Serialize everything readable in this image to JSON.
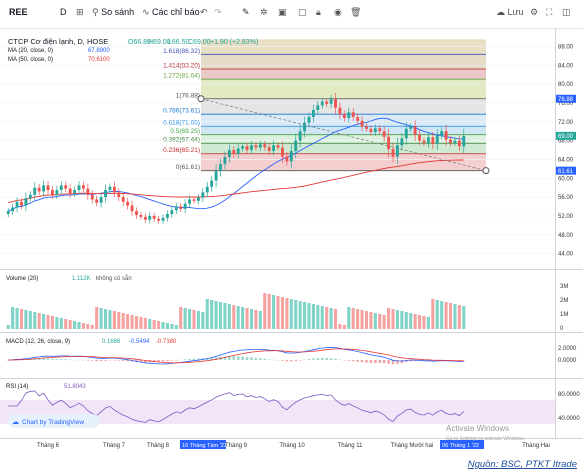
{
  "toolbar": {
    "symbol": "REE",
    "interval": "D",
    "compare_label": "So sánh",
    "indicators_label": "Các chỉ báo",
    "save_label": "Lưu"
  },
  "chart_data": [
    {
      "type": "candlestick",
      "title": "CTCP Cơ điện lạnh, D, HOSE",
      "ohlc_header": {
        "o": "O66.80",
        "h": "H69.00",
        "l": "L66.50",
        "c": "C69.00",
        "change": "+1.90 (+2.83%)"
      },
      "indicators": [
        {
          "name": "MA (20, close, 0)",
          "value": "67.8900",
          "color": "#2962ff"
        },
        {
          "name": "MA (50, close, 0)",
          "value": "70.6100",
          "color": "#e53935"
        }
      ],
      "price_axis_ticks": [
        "88.00",
        "84.00",
        "80.00",
        "76.00",
        "72.00",
        "68.00",
        "64.00",
        "60.00",
        "56.00",
        "52.00",
        "48.00",
        "44.00"
      ],
      "price_badges": [
        {
          "text": "76.88",
          "color": "#2962ff"
        },
        {
          "text": "69.00",
          "color": "#26a69a"
        },
        {
          "text": "61.61",
          "color": "#2962ff"
        }
      ],
      "fibonacci_levels": [
        {
          "label": "1.618(86.32)",
          "value": 86.32,
          "color": "#3f51b5"
        },
        {
          "label": "1.414(83.20)",
          "value": 83.2,
          "color": "#b71c1c"
        },
        {
          "label": "1.272(81.04)",
          "value": 81.04,
          "color": "#689f38"
        },
        {
          "label": "1(76.88)",
          "value": 76.88,
          "color": "#555555"
        },
        {
          "label": "0.786(73.61)",
          "value": 73.61,
          "color": "#1976d2"
        },
        {
          "label": "0.618(71.05)",
          "value": 71.05,
          "color": "#1e88e5"
        },
        {
          "label": "0.5(69.25)",
          "value": 69.25,
          "color": "#43a047"
        },
        {
          "label": "0.382(67.44)",
          "value": 67.44,
          "color": "#2e7d32"
        },
        {
          "label": "0.236(65.21)",
          "value": 65.21,
          "color": "#c62828"
        },
        {
          "label": "0(61.61)",
          "value": 61.61,
          "color": "#555555"
        }
      ],
      "close_series": [
        53.0,
        53.8,
        55.0,
        54.2,
        55.8,
        56.5,
        58.0,
        57.2,
        58.5,
        57.5,
        56.5,
        57.5,
        58.5,
        57.8,
        56.8,
        57.5,
        58.5,
        57.8,
        56.5,
        55.5,
        54.8,
        56.0,
        57.5,
        58.2,
        57.0,
        56.0,
        55.0,
        54.2,
        53.0,
        52.2,
        51.8,
        51.2,
        52.0,
        51.4,
        51.0,
        51.6,
        52.4,
        53.2,
        54.0,
        53.5,
        54.6,
        55.5,
        55.2,
        55.9,
        57.0,
        58.2,
        59.5,
        61.5,
        63.0,
        64.5,
        66.0,
        65.2,
        66.3,
        66.8,
        66.0,
        67.0,
        66.5,
        67.2,
        66.6,
        65.8,
        67.0,
        66.5,
        64.6,
        63.6,
        65.8,
        68.0,
        70.0,
        71.8,
        73.0,
        74.5,
        75.5,
        76.3,
        75.8,
        76.8,
        75.0,
        73.6,
        72.8,
        74.0,
        73.0,
        72.2,
        71.0,
        70.5,
        69.8,
        70.6,
        70.0,
        68.8,
        66.2,
        64.6,
        67.0,
        68.5,
        70.5,
        71.0,
        69.2,
        68.0,
        67.5,
        68.7,
        67.3,
        69.1,
        70.0,
        68.2,
        67.5,
        68.0,
        66.8,
        69.0
      ],
      "volume_axis_ticks": [
        "3M",
        "2M",
        "1M",
        "0"
      ],
      "macd_axis_ticks": [
        "2.0000",
        "0.0000"
      ],
      "rsi_axis_ticks": [
        "80.0000",
        "40.0000"
      ],
      "time_ticks": [
        "Tháng 6",
        "Tháng 7",
        "Tháng 8",
        "Tháng 9",
        "Tháng 10",
        "Tháng 11",
        "Tháng Mười hai",
        "Tháng Hai"
      ],
      "highlight_dates": [
        "16 Tháng Tám '21",
        "06 Tháng 1 '22"
      ]
    },
    {
      "type": "bar",
      "title": "Volume (20)",
      "values_label": "1.112K",
      "note": "không có sẵn"
    },
    {
      "type": "line",
      "title": "MACD (12, 26, close, 9)",
      "values": [
        "0.1686",
        "-0.5494",
        "-0.7180"
      ]
    },
    {
      "type": "line",
      "title": "RSI (14)",
      "values": [
        "51.8043"
      ]
    }
  ],
  "watermark": {
    "brand": "Chart by TradingView",
    "activate_title": "Activate Windows",
    "activate_sub": "Go to Settings to activate Windows."
  },
  "source": "Nguồn: BSC, PTKT Itrade"
}
